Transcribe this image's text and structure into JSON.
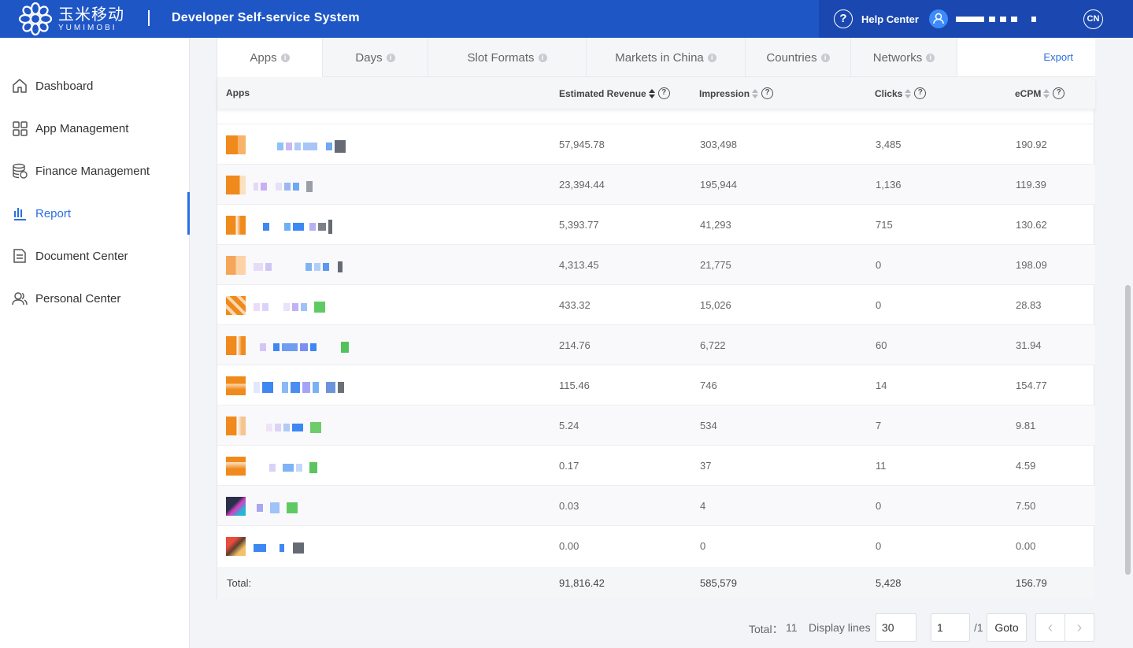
{
  "header": {
    "logo_cn": "玉米移动",
    "logo_en": "YUMIMOBI",
    "system_title": "Developer Self-service System",
    "help_label": "Help Center",
    "language": "CN"
  },
  "sidebar": {
    "items": [
      {
        "label": "Dashboard",
        "icon": "home-icon"
      },
      {
        "label": "App Management",
        "icon": "grid-icon"
      },
      {
        "label": "Finance Management",
        "icon": "coins-icon"
      },
      {
        "label": "Report",
        "icon": "bar-chart-icon",
        "active": true
      },
      {
        "label": "Document Center",
        "icon": "document-icon"
      },
      {
        "label": "Personal Center",
        "icon": "users-icon"
      }
    ]
  },
  "tabs": [
    {
      "label": "Apps",
      "active": true
    },
    {
      "label": "Days"
    },
    {
      "label": "Slot Formats"
    },
    {
      "label": "Markets in China"
    },
    {
      "label": "Countries"
    },
    {
      "label": "Networks"
    }
  ],
  "export_label": "Export",
  "table": {
    "columns": [
      "Apps",
      "Estimated Revenue",
      "Impression",
      "Clicks",
      "eCPM"
    ],
    "rows": [
      {
        "revenue": "57,945.78",
        "impression": "303,498",
        "clicks": "3,485",
        "ecpm": "190.92"
      },
      {
        "revenue": "23,394.44",
        "impression": "195,944",
        "clicks": "1,136",
        "ecpm": "119.39"
      },
      {
        "revenue": "5,393.77",
        "impression": "41,293",
        "clicks": "715",
        "ecpm": "130.62"
      },
      {
        "revenue": "4,313.45",
        "impression": "21,775",
        "clicks": "0",
        "ecpm": "198.09"
      },
      {
        "revenue": "433.32",
        "impression": "15,026",
        "clicks": "0",
        "ecpm": "28.83"
      },
      {
        "revenue": "214.76",
        "impression": "6,722",
        "clicks": "60",
        "ecpm": "31.94"
      },
      {
        "revenue": "115.46",
        "impression": "746",
        "clicks": "14",
        "ecpm": "154.77"
      },
      {
        "revenue": "5.24",
        "impression": "534",
        "clicks": "7",
        "ecpm": "9.81"
      },
      {
        "revenue": "0.17",
        "impression": "37",
        "clicks": "11",
        "ecpm": "4.59"
      },
      {
        "revenue": "0.03",
        "impression": "4",
        "clicks": "0",
        "ecpm": "7.50"
      },
      {
        "revenue": "0.00",
        "impression": "0",
        "clicks": "0",
        "ecpm": "0.00"
      }
    ],
    "total": {
      "label": "Total:",
      "revenue": "91,816.42",
      "impression": "585,579",
      "clicks": "5,428",
      "ecpm": "156.79"
    }
  },
  "pagination": {
    "total_label": "Total：",
    "total_count": "11",
    "display_lines_label": "Display lines",
    "display_lines_value": "30",
    "page_value": "1",
    "page_total": "/1",
    "goto_label": "Goto"
  },
  "colors": {
    "header_bg": "#1f56c6",
    "accent": "#2a6fe0",
    "app_icon_orange": "#f08a1c"
  }
}
